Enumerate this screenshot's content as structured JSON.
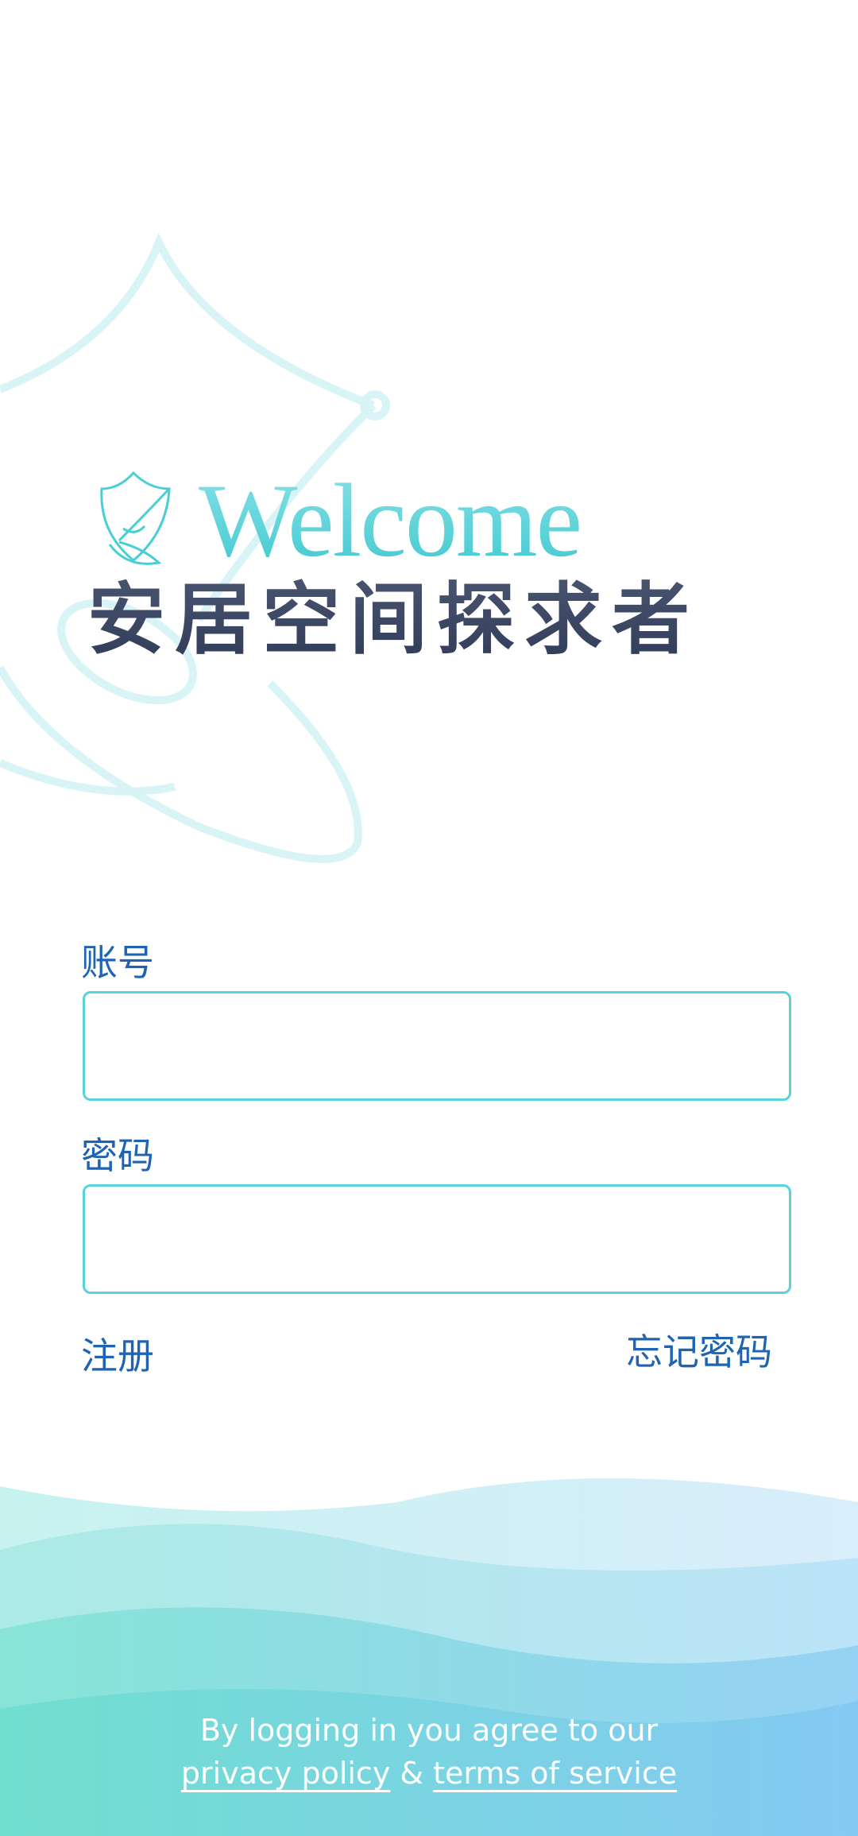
{
  "brand": {
    "welcome": "Welcome",
    "app_name": "安居空间探求者",
    "logo_icon": "shield-leaf-icon"
  },
  "login": {
    "account_label": "账号",
    "account_value": "",
    "password_label": "密码",
    "password_value": "",
    "register_label": "注册",
    "forgot_label": "忘记密码"
  },
  "legal": {
    "line1": "By logging in you agree to our",
    "privacy": "privacy policy",
    "amp": "&",
    "terms": "terms of service"
  },
  "colors": {
    "accent": "#58d3dc",
    "label": "#1f63b3",
    "title": "#2f3b58",
    "wave_left": "#6fe0d2",
    "wave_right": "#8ccdf4"
  }
}
